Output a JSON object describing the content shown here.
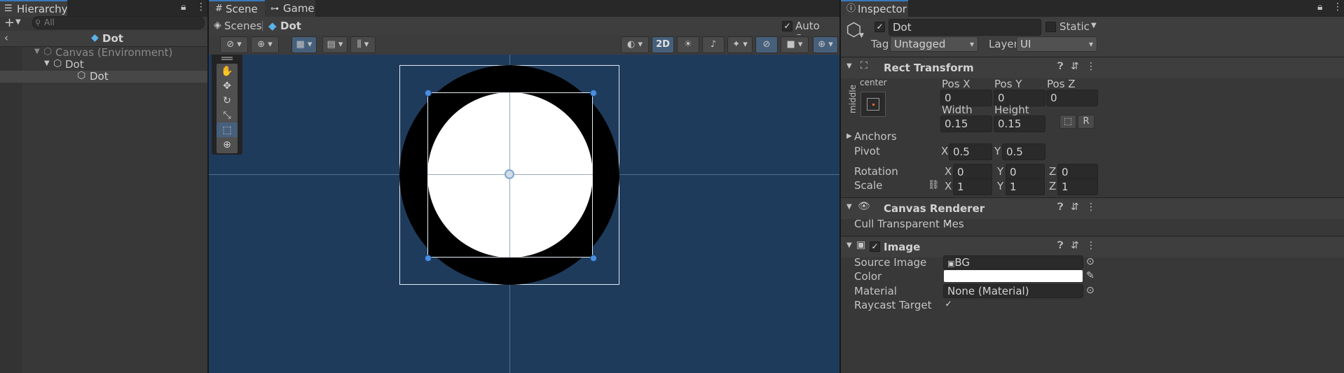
{
  "hierarchy": {
    "tab_label": "Hierarchy",
    "search_placeholder": "All",
    "breadcrumb": "Dot",
    "tree": [
      {
        "label": "Canvas (Environment)"
      },
      {
        "label": "Dot"
      },
      {
        "label": "Dot"
      }
    ]
  },
  "scene": {
    "tabs": [
      {
        "label": "Scene"
      },
      {
        "label": "Game"
      }
    ],
    "breadcrumb": {
      "root": "Scenes",
      "current": "Dot"
    },
    "auto_save_label": "Auto Save",
    "mode_2d_label": "2D"
  },
  "inspector": {
    "tab_label": "Inspector",
    "object_name": "Dot",
    "static_label": "Static",
    "tag_label": "Tag",
    "tag_value": "Untagged",
    "layer_label": "Layer",
    "layer_value": "UI",
    "rect_transform": {
      "title": "Rect Transform",
      "anchor_h": "center",
      "anchor_v": "middle",
      "posx_label": "Pos X",
      "posx": "0",
      "posy_label": "Pos Y",
      "posy": "0",
      "posz_label": "Pos Z",
      "posz": "0",
      "width_label": "Width",
      "width": "0.15",
      "height_label": "Height",
      "height": "0.15",
      "r_button": "R",
      "anchors_label": "Anchors",
      "pivot_label": "Pivot",
      "pivot_x": "0.5",
      "pivot_y": "0.5",
      "rotation_label": "Rotation",
      "rot_x": "0",
      "rot_y": "0",
      "rot_z": "0",
      "scale_label": "Scale",
      "scale_x": "1",
      "scale_y": "1",
      "scale_z": "1",
      "x": "X",
      "y": "Y",
      "z": "Z"
    },
    "canvas_renderer": {
      "title": "Canvas Renderer",
      "cull_label": "Cull Transparent Mes"
    },
    "image": {
      "title": "Image",
      "source_label": "Source Image",
      "source_value": "BG",
      "color_label": "Color",
      "material_label": "Material",
      "material_value": "None (Material)",
      "raycast_label": "Raycast Target"
    }
  },
  "colors": {
    "accent": "#3a79bb",
    "scene_bg": "#1f3b5c",
    "panel_bg": "#383838"
  }
}
